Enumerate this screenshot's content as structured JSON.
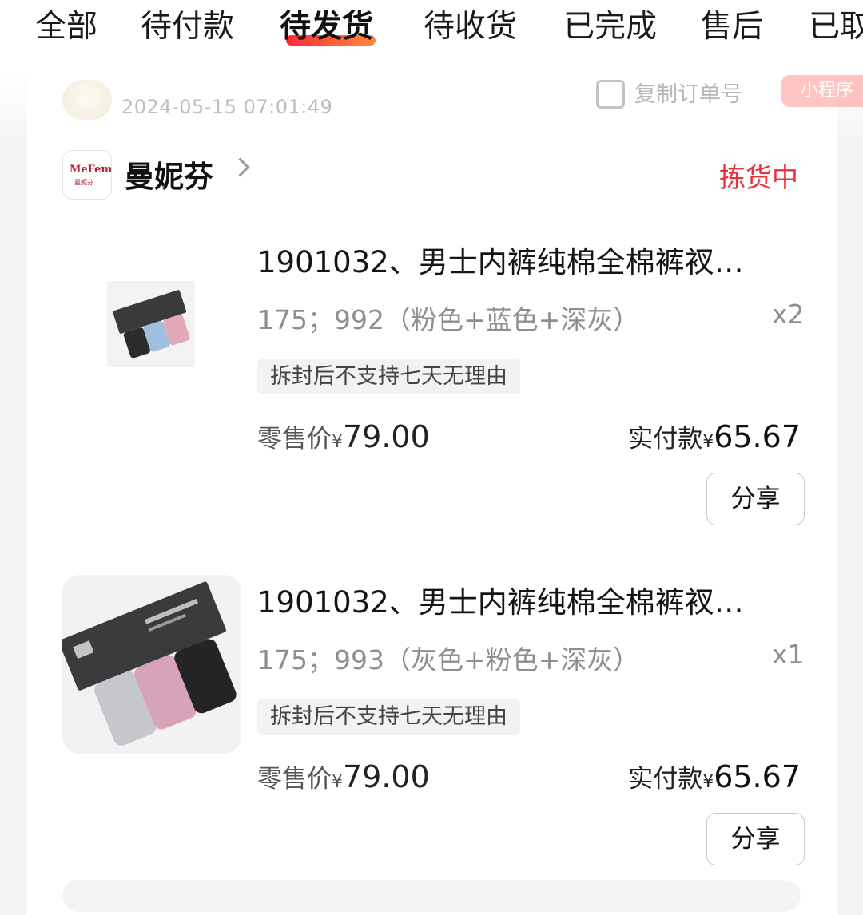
{
  "tabs": [
    {
      "label": "全部",
      "active": false
    },
    {
      "label": "待付款",
      "active": false
    },
    {
      "label": "待发货",
      "active": true
    },
    {
      "label": "待收货",
      "active": false
    },
    {
      "label": "已完成",
      "active": false
    },
    {
      "label": "售后",
      "active": false
    },
    {
      "label": "已取",
      "active": false
    }
  ],
  "order": {
    "time": "2024-05-15 07:01:49",
    "copy_label": "复制订单号",
    "source_tag": "小程序",
    "shop": {
      "name": "曼妮芬",
      "logo_text": "MeFem",
      "logo_sub": "曼妮芬"
    },
    "status": "拣货中",
    "items": [
      {
        "title": "1901032、男士内裤纯棉全棉裤衩…",
        "spec": "175；992（粉色+蓝色+深灰）",
        "qty": "x2",
        "tag": "拆封后不支持七天无理由",
        "retail_label": "零售价",
        "currency": "¥",
        "retail_price": "79.00",
        "paid_label": "实付款",
        "paid_price": "65.67",
        "share_label": "分享"
      },
      {
        "title": "1901032、男士内裤纯棉全棉裤衩…",
        "spec": "175；993（灰色+粉色+深灰）",
        "qty": "x1",
        "tag": "拆封后不支持七天无理由",
        "retail_label": "零售价",
        "currency": "¥",
        "retail_price": "79.00",
        "paid_label": "实付款",
        "paid_price": "65.67",
        "share_label": "分享"
      }
    ]
  },
  "colors": {
    "accent_red": "#e8313f",
    "tab_underline_start": "#ff2a3a",
    "tab_underline_end": "#ff8a3c"
  }
}
